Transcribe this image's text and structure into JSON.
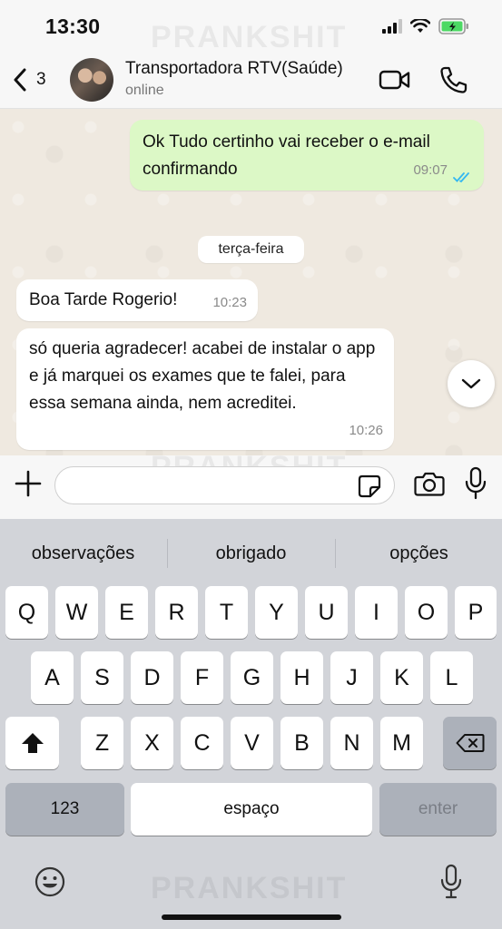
{
  "status_bar": {
    "time": "13:30",
    "watermark": "PRANKSHIT"
  },
  "header": {
    "back_count": "3",
    "contact_name": "Transportadora RTV(Saúde)",
    "contact_status": "online"
  },
  "chat": {
    "messages": [
      {
        "direction": "outgoing",
        "text": "Ok  Tudo certinho vai receber o e-mail confirmando",
        "time": "09:07",
        "read": true
      },
      {
        "direction": "incoming",
        "text": "Boa Tarde Rogerio!",
        "time": "10:23"
      },
      {
        "direction": "incoming",
        "text": "só queria agradecer! acabei de instalar o app e já marquei os exames que te falei, para essa semana ainda, nem acreditei.",
        "time": "10:26"
      }
    ],
    "day_separator": "terça-feira"
  },
  "input_bar": {
    "value": "",
    "placeholder": ""
  },
  "keyboard": {
    "suggestions": [
      "observações",
      "obrigado",
      "opções"
    ],
    "row1": [
      "Q",
      "W",
      "E",
      "R",
      "T",
      "Y",
      "U",
      "I",
      "O",
      "P"
    ],
    "row2": [
      "A",
      "S",
      "D",
      "F",
      "G",
      "H",
      "J",
      "K",
      "L"
    ],
    "row3": [
      "Z",
      "X",
      "C",
      "V",
      "B",
      "N",
      "M"
    ],
    "numbers_key": "123",
    "space_key": "espaço",
    "enter_key": "enter"
  },
  "colors": {
    "outgoing_bubble": "#dcf8c6",
    "incoming_bubble": "#ffffff",
    "read_ticks": "#34b7f1"
  },
  "icons": [
    "back-chevron-icon",
    "video-call-icon",
    "phone-icon",
    "chevron-down-icon",
    "plus-icon",
    "sticker-icon",
    "camera-icon",
    "microphone-icon",
    "shift-icon",
    "backspace-icon",
    "emoji-icon",
    "dictation-icon"
  ]
}
